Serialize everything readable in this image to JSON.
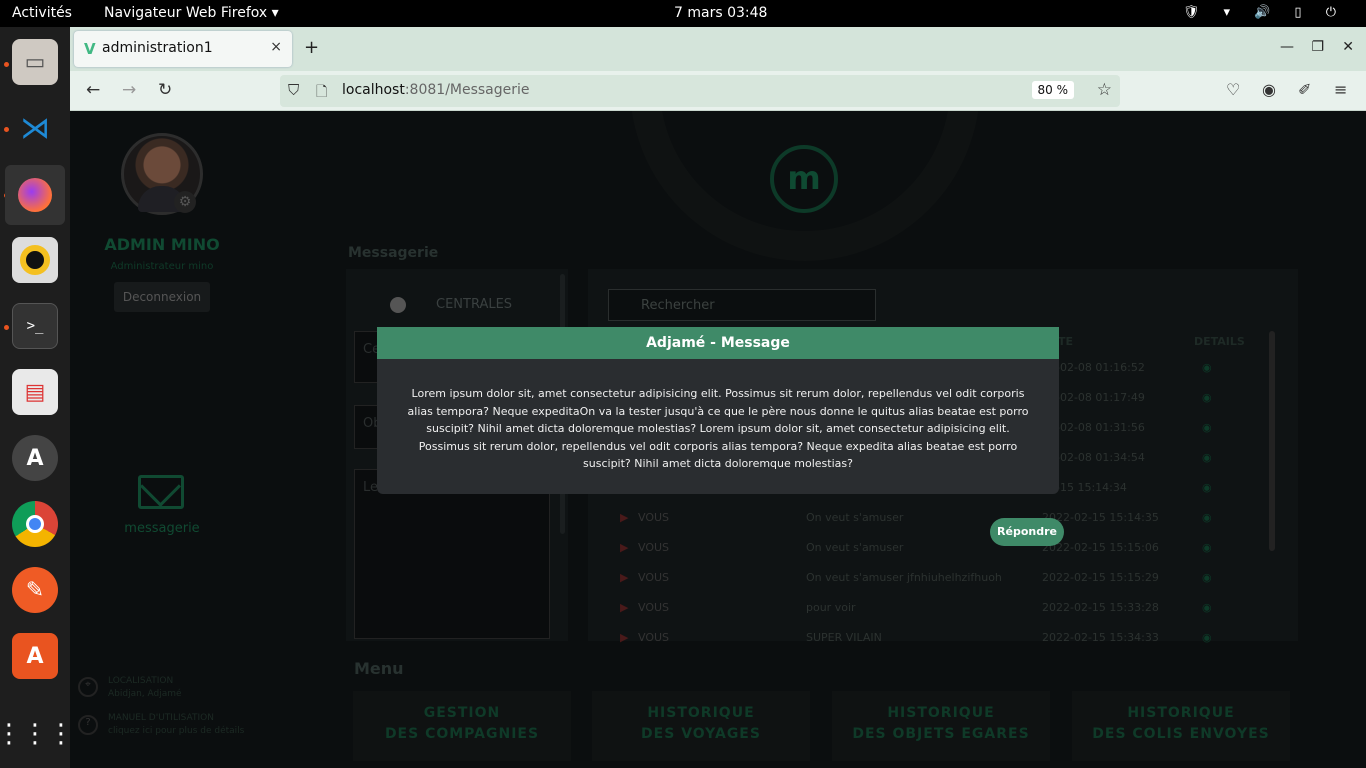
{
  "topbar": {
    "activities": "Activités",
    "app": "Navigateur Web Firefox ▾",
    "clock": "7 mars  03:48",
    "tray": "🛡 ▾ 🔊 ▯ ⏻"
  },
  "browser": {
    "tab_title": "administration1",
    "tab_close": "×",
    "new_tab": "+",
    "url_host": "localhost",
    "url_rest": ":8081/Messagerie",
    "zoom": "80 %"
  },
  "sidebar": {
    "name": "ADMIN MINO",
    "role": "Administrateur mino",
    "logout": "Deconnexion",
    "messaging": "messagerie",
    "location_title": "LOCALISATION",
    "location_value": "Abidjan, Adjamé",
    "manual_title": "MANUEL D'UTILISATION",
    "manual_value": "cliquez ici pour plus de détails"
  },
  "messagerie": {
    "title": "Messagerie",
    "centrales": "CENTRALES",
    "field1": "Ce",
    "field2": "Ob",
    "message_placeholder": "Le message",
    "search_placeholder": "Rechercher",
    "col_date": "TE",
    "col_details": "DETAILS",
    "rows": [
      {
        "who": "",
        "obj": "",
        "date": "12-02-08 01:16:52"
      },
      {
        "who": "",
        "obj": "",
        "date": "12-02-08 01:17:49"
      },
      {
        "who": "",
        "obj": "",
        "date": "12-02-08 01:31:56"
      },
      {
        "who": "",
        "obj": "",
        "date": "12-02-08 01:34:54"
      },
      {
        "who": "",
        "obj": "",
        "date": "02-15 15:14:34"
      },
      {
        "who": "VOUS",
        "obj": "On veut s'amuser",
        "date": "2022-02-15 15:14:35"
      },
      {
        "who": "VOUS",
        "obj": "On veut s'amuser",
        "date": "2022-02-15 15:15:06"
      },
      {
        "who": "VOUS",
        "obj": "On veut s'amuser jfnhiuhelhzifhuoh",
        "date": "2022-02-15 15:15:29"
      },
      {
        "who": "VOUS",
        "obj": "pour voir",
        "date": "2022-02-15 15:33:28"
      },
      {
        "who": "VOUS",
        "obj": "SUPER VILAIN",
        "date": "2022-02-15 15:34:33"
      }
    ]
  },
  "menu": {
    "title": "Menu",
    "cards": [
      {
        "l1": "GESTION",
        "l2": "DES COMPAGNIES"
      },
      {
        "l1": "HISTORIQUE",
        "l2": "DES VOYAGES"
      },
      {
        "l1": "HISTORIQUE",
        "l2": "DES OBJETS EGARES"
      },
      {
        "l1": "HISTORIQUE",
        "l2": "DES COLIS ENVOYES"
      }
    ]
  },
  "modal": {
    "title": "Adjamé - Message",
    "body": "Lorem ipsum dolor sit, amet consectetur adipisicing elit. Possimus sit rerum dolor, repellendus vel odit corporis alias tempora? Neque expeditaOn va la tester jusqu'à ce que le père nous donne le quitus alias beatae est porro suscipit? Nihil amet dicta doloremque molestias? Lorem ipsum dolor sit, amet consectetur adipisicing elit. Possimus sit rerum dolor, repellendus vel odit corporis alias tempora? Neque expedita alias beatae est porro suscipit? Nihil amet dicta doloremque molestias?",
    "reply": "Répondre"
  },
  "colors": {
    "accent": "#3f8a68",
    "dark_green": "#0f3a28"
  }
}
